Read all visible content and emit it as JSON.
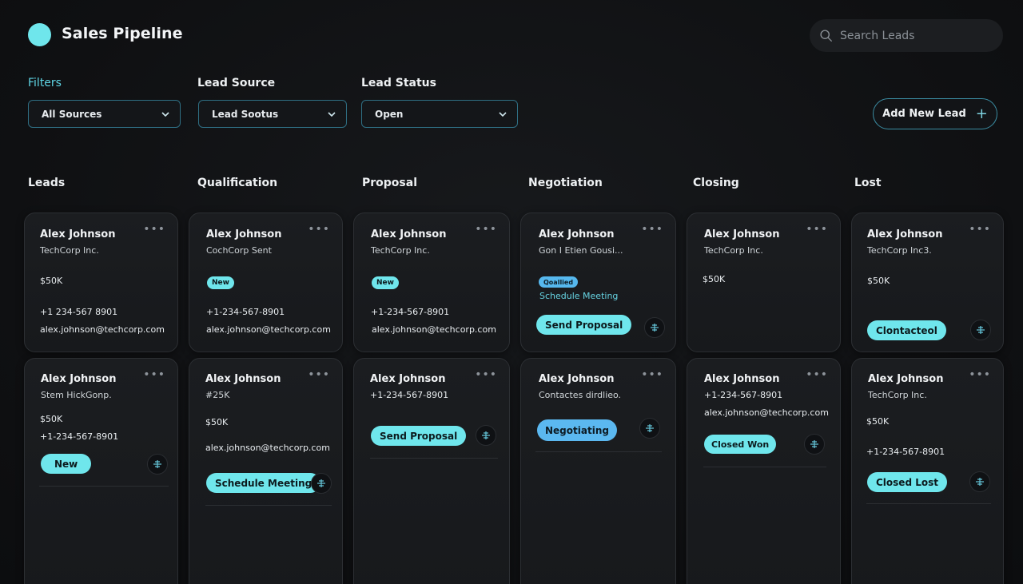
{
  "app": {
    "title": "Sales Pipeline"
  },
  "search": {
    "placeholder": "Search Leads"
  },
  "filters": {
    "label": "Filters",
    "source_label": "Lead Source",
    "status_label": "Lead Status",
    "sources_value": "All Sources",
    "lead_source_value": "Lead Sootus",
    "status_value": "Open"
  },
  "actions": {
    "add_lead": "Add New Lead"
  },
  "columns": [
    "Leads",
    "Qualification",
    "Proposal",
    "Negotiation",
    "Closing",
    "Lost"
  ],
  "cards": {
    "c1": {
      "name": "Alex Johnson",
      "company": "TechCorp Inc.",
      "amount": "$50K",
      "phone": "+1 234-567 8901",
      "email": "alex.johnson@techcorp.com"
    },
    "c2": {
      "name": "Alex Johnson",
      "company": "CochCorp Sent",
      "badge": "New",
      "phone": "+1-234-567-8901",
      "email": "alex.johnson@techcorp.com"
    },
    "c3": {
      "name": "Alex Johnson",
      "company": "TechCorp Inc.",
      "badge": "New",
      "phone": "+1-234-567-8901",
      "email": "alex.johnson@techcorp.com"
    },
    "c4": {
      "name": "Alex Johnson",
      "company": "Gon I Etien Gousi...",
      "badge": "Qoallied",
      "link": "Schedule Meeting",
      "action": "Send Proposal"
    },
    "c5": {
      "name": "Alex Johnson",
      "company": "TechCorp Inc.",
      "amount": "$50K"
    },
    "c6": {
      "name": "Alex Johnson",
      "company": "TechCorp Inc3.",
      "amount": "$50K",
      "status": "Clontacteol"
    },
    "c7": {
      "name": "Alex Johnson",
      "company": "Stem HickGonp.",
      "amount": "$50K",
      "phone": "+1-234-567-8901",
      "status": "New"
    },
    "c8": {
      "name": "Alex Johnson",
      "amount_raw": "#25K",
      "amount": "$50K",
      "email": "alex.johnson@techcorp.com",
      "action": "Schedule Meeting"
    },
    "c9": {
      "name": "Alex Johnson",
      "phone": "+1-234-567-8901",
      "action": "Send Proposal"
    },
    "c10": {
      "name": "Alex Johnson",
      "company": "Contactes dirdlieo.",
      "status": "Negotiating"
    },
    "c11": {
      "name": "Alex Johnson",
      "phone": "+1-234-567-8901",
      "email": "alex.johnson@techcorp.com",
      "status": "Closed Won"
    },
    "c12": {
      "name": "Alex Johnson",
      "company": "TechCorp Inc.",
      "amount": "$50K",
      "phone": "+1-234-567-8901",
      "status": "Closed Lost"
    }
  },
  "colors": {
    "accent": "#6fe6ec",
    "blue_badge": "#5bb8f0",
    "background": "#0f1012"
  },
  "icons": [
    "logo-dot-icon",
    "search-icon",
    "chevron-down-icon",
    "plus-icon",
    "more-icon",
    "transfer-icon"
  ]
}
